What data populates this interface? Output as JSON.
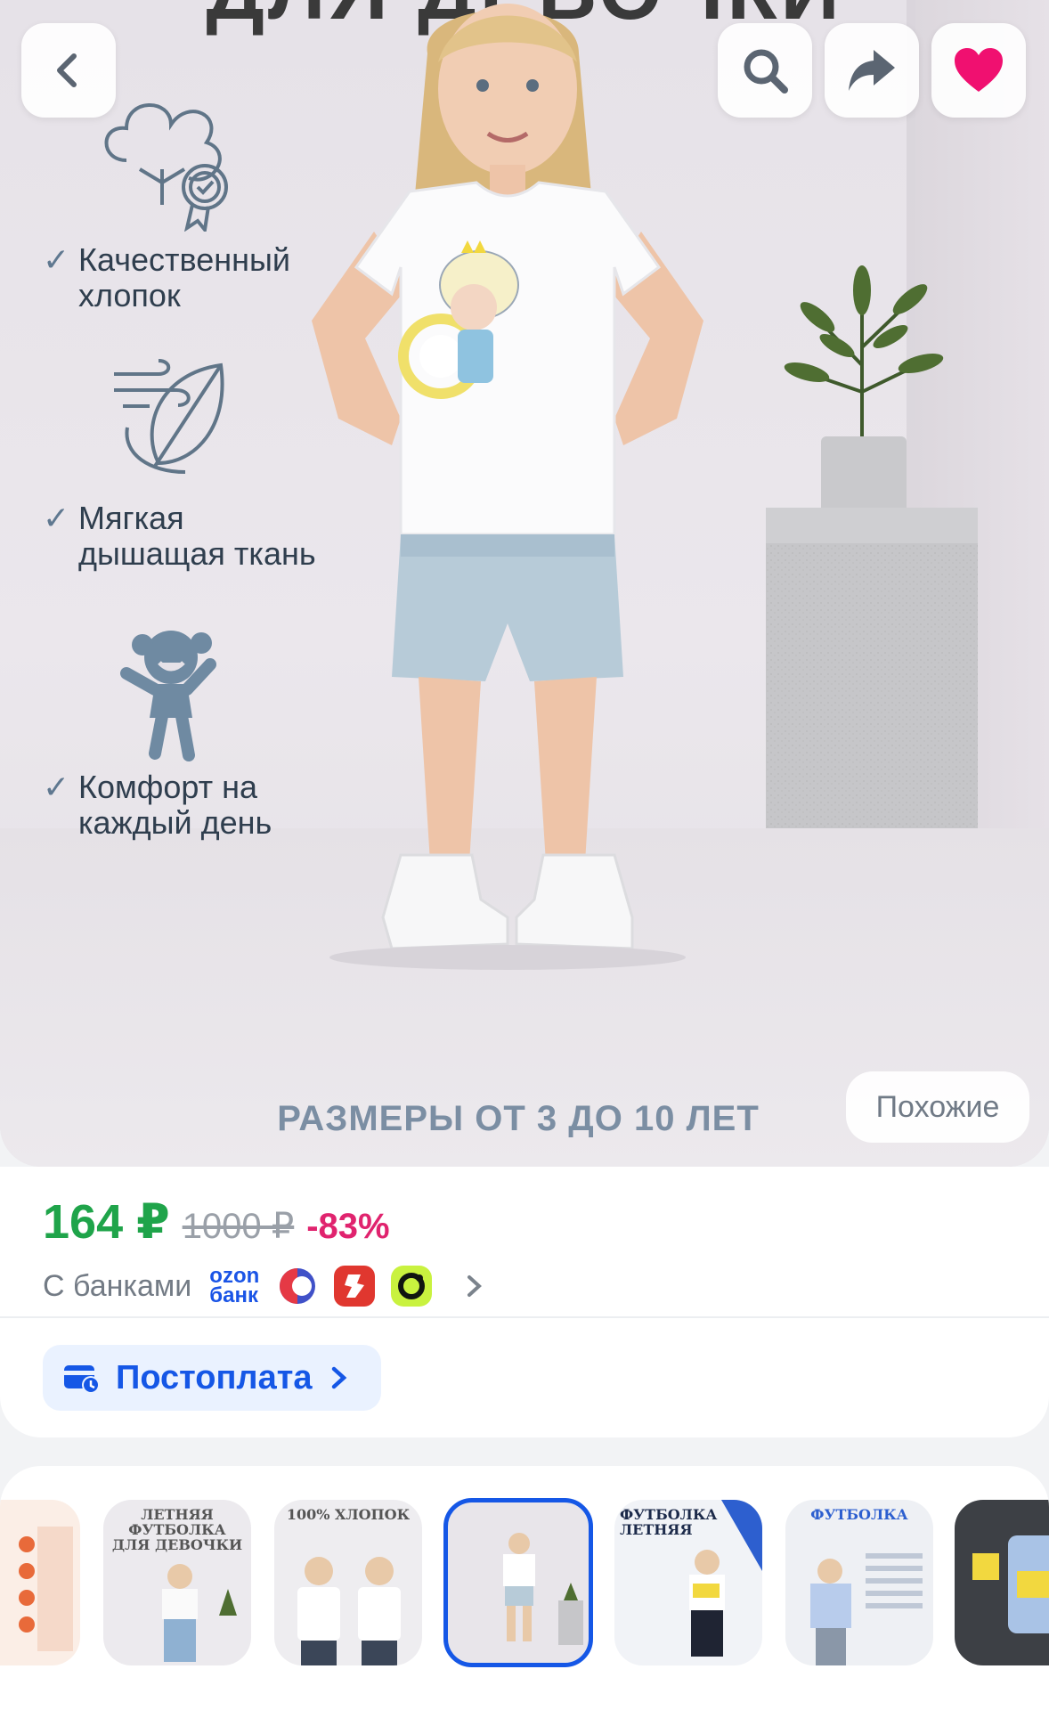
{
  "hero": {
    "top_text": "ДЛЯ ДЕВОЧКИ",
    "features": [
      {
        "check": "✓",
        "text": "Качественный хлопок",
        "line1": "Качественный",
        "line2": "хлопок",
        "icon": "cotton-quality-icon"
      },
      {
        "check": "✓",
        "text": "Мягкая дышащая ткань",
        "line1": "Мягкая",
        "line2": "дышащая ткань",
        "icon": "breathable-feather-icon"
      },
      {
        "check": "✓",
        "text": "Комфорт на каждый день",
        "line1": "Комфорт на",
        "line2": "каждый день",
        "icon": "happy-child-icon"
      }
    ],
    "bottom_caption": "РАЗМЕРЫ ОТ 3 ДО 10 ЛЕТ",
    "similar_label": "Похожие",
    "buttons": {
      "back": "back-icon",
      "search": "search-icon",
      "share": "share-icon",
      "favorite": "heart-icon"
    }
  },
  "price": {
    "current": "164 ₽",
    "old": "1000 ₽",
    "discount": "-83%",
    "banks_label": "С банками",
    "ozon_bank": "ozon банк",
    "ozon_line1": "ozon",
    "ozon_line2": "банк",
    "colors": {
      "current": "#1fa44a",
      "discount": "#e0236e",
      "accent": "#1557e6"
    }
  },
  "postpay": {
    "label": "Постоплата"
  },
  "thumbnails": [
    {
      "caption": "",
      "selected": false
    },
    {
      "caption": "ЛЕТНЯЯ ФУТБОЛКА ДЛЯ ДЕВОЧКИ",
      "selected": false
    },
    {
      "caption": "100% ХЛОПОК",
      "selected": false
    },
    {
      "caption": "",
      "selected": true
    },
    {
      "caption": "ФУТБОЛКА ЛЕТНЯЯ",
      "selected": false
    },
    {
      "caption": "ФУТБОЛКА",
      "selected": false
    },
    {
      "caption": "",
      "selected": false
    }
  ]
}
